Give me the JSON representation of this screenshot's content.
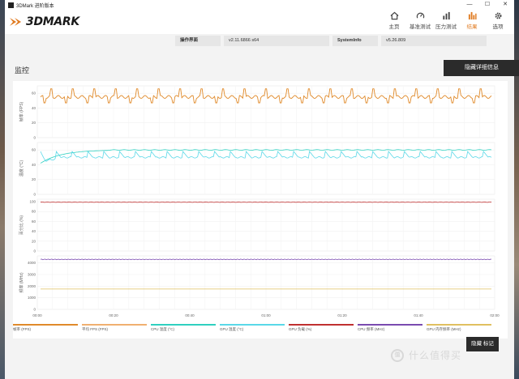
{
  "window": {
    "title": "3DMark 进阶版本",
    "min": "—",
    "max": "☐",
    "close": "✕"
  },
  "header": {
    "logo": "3DMARK",
    "nav": [
      {
        "label": "主页",
        "icon": "home-icon",
        "active": false
      },
      {
        "label": "基准测试",
        "icon": "gauge-icon",
        "active": false
      },
      {
        "label": "压力测试",
        "icon": "bars-icon",
        "active": false
      },
      {
        "label": "结果",
        "icon": "results-icon",
        "active": true
      },
      {
        "label": "选项",
        "icon": "gear-icon",
        "active": false
      }
    ]
  },
  "info": {
    "os_label": "操作界面",
    "os_value": "v2.11.6866 s64",
    "si_label": "SystemInfo",
    "si_value": "v5.26.809"
  },
  "monitor": {
    "title": "监控",
    "hide_details": "隐藏详细信息",
    "hide_marks": "隐藏 标记"
  },
  "chart_data": {
    "type": "line",
    "x_ticks": [
      "00:00",
      "00:20",
      "00:40",
      "01:00",
      "01:20",
      "01:40",
      "02:00"
    ],
    "panels": [
      {
        "ylabel": "帧率 (FPS)",
        "yticks": [
          "60",
          "40",
          "20",
          "0"
        ],
        "ylim": [
          0,
          70
        ]
      },
      {
        "ylabel": "温度 (°C)",
        "yticks": [
          "60",
          "40",
          "20",
          "0"
        ],
        "ylim": [
          0,
          70
        ]
      },
      {
        "ylabel": "百分比 (%)",
        "yticks": [
          "100",
          "80",
          "60",
          "40",
          "20",
          "0"
        ],
        "ylim": [
          0,
          105
        ]
      },
      {
        "ylabel": "频率 (MHz)",
        "yticks": [
          "4000",
          "3000",
          "2000",
          "1000",
          "0"
        ],
        "ylim": [
          0,
          4600
        ]
      }
    ],
    "series": [
      {
        "name": "帧率 (FPS)",
        "panel": 0,
        "color": "#e08a2a"
      },
      {
        "name": "平均 FPS (FPS)",
        "panel": 0,
        "color": "#f0b070"
      },
      {
        "name": "CPU 温度 (°C)",
        "panel": 1,
        "color": "#2fd0c0"
      },
      {
        "name": "GPU 温度 (°C)",
        "panel": 1,
        "color": "#5ad8e8"
      },
      {
        "name": "GPU 负载 (%)",
        "panel": 2,
        "color": "#c03030"
      },
      {
        "name": "CPU 频率 (MHz)",
        "panel": 3,
        "color": "#7a4ab0"
      },
      {
        "name": "GPU 内存频率 (MHz)",
        "panel": 3,
        "color": "#e0c060"
      }
    ],
    "values": {
      "fps_base": 55,
      "fps_dip": 47,
      "fps_peak": 66,
      "cpu_temp": 60,
      "gpu_temp_base": 50,
      "gpu_temp_peak": 58,
      "gpu_load": 99,
      "cpu_clock": 4300,
      "gpu_mem_clock": 1750
    }
  }
}
